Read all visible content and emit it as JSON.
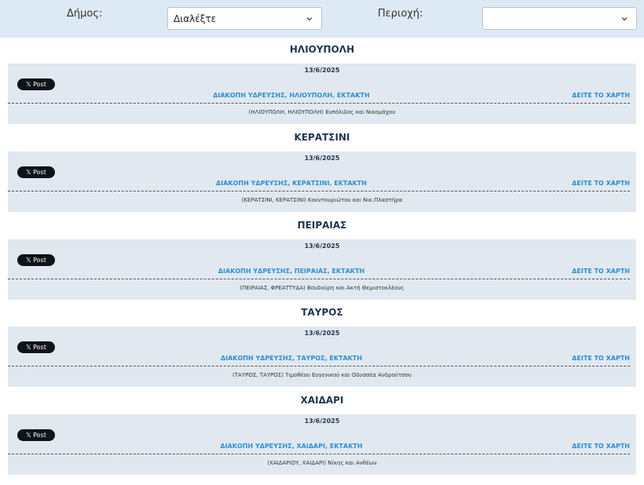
{
  "filters": {
    "municipality_label": "Δήμος:",
    "municipality_value": "Διαλέξτε",
    "area_label": "Περιοχή:",
    "area_value": ""
  },
  "sections": [
    {
      "region": "ΗΛΙΟΥΠΟΛΗ",
      "date": "13/6/2025",
      "x_post": "Post",
      "headline": "ΔΙΑΚΟΠΗ ΥΔΡΕΥΣΗΣ, ΗΛΙΟΥΠΟΛΗ, ΕΚΤΑΚΤΗ",
      "map_link": "ΔΕΙΤΕ ΤΟ ΧΑΡΤΗ",
      "detail": "(ΗΛΙΟΥΠΟΛΗ, ΗΛΙΟΥΠΟΛΗ) Ευπόλιδος και Νικομάχου"
    },
    {
      "region": "ΚΕΡΑΤΣΙΝΙ",
      "date": "13/6/2025",
      "x_post": "Post",
      "headline": "ΔΙΑΚΟΠΗ ΥΔΡΕΥΣΗΣ, ΚΕΡΑΤΣΙΝΙ, ΕΚΤΑΚΤΗ",
      "map_link": "ΔΕΙΤΕ ΤΟ ΧΑΡΤΗ",
      "detail": "(ΚΕΡΑΤΣΙΝΙ, ΚΕΡΑΤΣΙΝΙ) Κουντουριώτου και Νικ.Πλαστήρα"
    },
    {
      "region": "ΠΕΙΡΑΙΑΣ",
      "date": "13/6/2025",
      "x_post": "Post",
      "headline": "ΔΙΑΚΟΠΗ ΥΔΡΕΥΣΗΣ, ΠΕΙΡΑΙΑΣ, ΕΚΤΑΚΤΗ",
      "map_link": "ΔΕΙΤΕ ΤΟ ΧΑΡΤΗ",
      "detail": "(ΠΕΙΡΑΙΑΣ, ΦΡΕΑΤΤΥΔΑ) Βουδούρη και Ακτή Θεμιστοκλέους"
    },
    {
      "region": "ΤΑΥΡΟΣ",
      "date": "13/6/2025",
      "x_post": "Post",
      "headline": "ΔΙΑΚΟΠΗ ΥΔΡΕΥΣΗΣ, ΤΑΥΡΟΣ, ΕΚΤΑΚΤΗ",
      "map_link": "ΔΕΙΤΕ ΤΟ ΧΑΡΤΗ",
      "detail": "(ΤΑΥΡΟΣ, ΤΑΥΡΟΣ) Τιμοθέου Ευγενικού και Οδυσσέα Ανδρούτσου"
    },
    {
      "region": "ΧΑΙΔΑΡΙ",
      "date": "13/6/2025",
      "x_post": "Post",
      "headline": "ΔΙΑΚΟΠΗ ΥΔΡΕΥΣΗΣ, ΧΑΙΔΑΡΙ, ΕΚΤΑΚΤΗ",
      "map_link": "ΔΕΙΤΕ ΤΟ ΧΑΡΤΗ",
      "detail": "(ΧΑΙΔΑΡΙΟΥ, ΧΑΙΔΑΡΙ) Νίκης και Ανθέων"
    }
  ],
  "colors": {
    "filter_bar": "#dde9f5",
    "card_bg": "#e1e8ef",
    "link": "#2c8fd1",
    "title": "#1f3550"
  }
}
